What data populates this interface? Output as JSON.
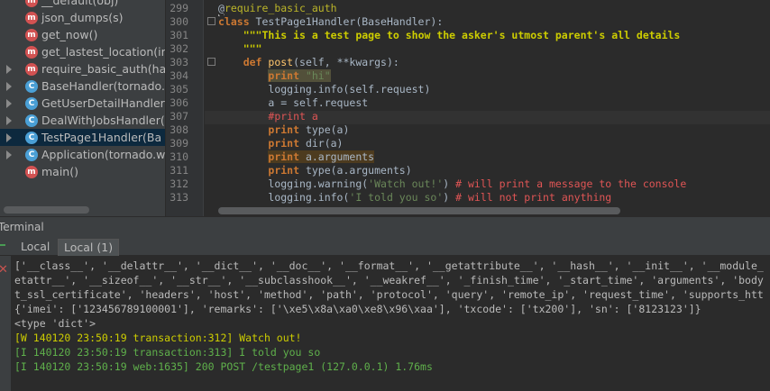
{
  "structure": {
    "items": [
      {
        "badge": "m",
        "label": "__default(obj)",
        "expandable": false,
        "selected": false
      },
      {
        "badge": "m",
        "label": "json_dumps(s)",
        "expandable": false,
        "selected": false
      },
      {
        "badge": "m",
        "label": "get_now()",
        "expandable": false,
        "selected": false
      },
      {
        "badge": "m",
        "label": "get_lastest_location(im",
        "expandable": false,
        "selected": false
      },
      {
        "badge": "m",
        "label": "require_basic_auth(ha",
        "expandable": true,
        "selected": false
      },
      {
        "badge": "C",
        "label": "BaseHandler(tornado.",
        "expandable": true,
        "selected": false
      },
      {
        "badge": "C",
        "label": "GetUserDetailHandler",
        "expandable": true,
        "selected": false
      },
      {
        "badge": "C",
        "label": "DealWithJobsHandler(",
        "expandable": true,
        "selected": false
      },
      {
        "badge": "C",
        "label": "TestPage1Handler(Ba",
        "expandable": true,
        "selected": true
      },
      {
        "badge": "C",
        "label": "Application(tornado.w",
        "expandable": true,
        "selected": false
      },
      {
        "badge": "m",
        "label": "main()",
        "expandable": false,
        "selected": false
      }
    ]
  },
  "editor": {
    "line_numbers": [
      "299",
      "300",
      "301",
      "302",
      "303",
      "304",
      "305",
      "306",
      "307",
      "308",
      "309",
      "310",
      "311",
      "312",
      "313"
    ],
    "current_line": "307"
  },
  "terminal": {
    "title": "Terminal",
    "tabs": [
      "Local",
      "Local (1)"
    ],
    "active_tab": "Local (1)",
    "lines": [
      {
        "text": "['__class__', '__delattr__', '__dict__', '__doc__', '__format__', '__getattribute__', '__hash__', '__init__', '__module_",
        "level": "plain"
      },
      {
        "text": "etattr__', '__sizeof__', '__str__', '__subclasshook__', '__weakref__', '_finish_time', '_start_time', 'arguments', 'body",
        "level": "plain"
      },
      {
        "text": "t_ssl_certificate', 'headers', 'host', 'method', 'path', 'protocol', 'query', 'remote_ip', 'request_time', 'supports_htt",
        "level": "plain"
      },
      {
        "text": "{'imei': ['123456789100001'], 'remarks': ['\\xe5\\x8a\\xa0\\xe8\\x96\\xaa'], 'txcode': ['tx200'], 'sn': ['8123123']}",
        "level": "plain"
      },
      {
        "text": "<type 'dict'>",
        "level": "plain"
      },
      {
        "text": "[W 140120 23:50:19 transaction:312] Watch out!",
        "level": "warn"
      },
      {
        "text": "[I 140120 23:50:19 transaction:313] I told you so",
        "level": "info"
      },
      {
        "text": "[I 140120 23:50:19 web:1635] 200 POST /testpage1 (127.0.0.1) 1.76ms",
        "level": "info"
      }
    ]
  },
  "code": {
    "l299_at": "@",
    "l299_name": "require_basic_auth",
    "l300_kw": "class",
    "l300_name": " TestPage1Handler(BaseHandler):",
    "l301_doc": "\"\"\"This is a test page to show the asker's utmost parent's all details",
    "l302_doc": "\"\"\"",
    "l303_kw": "def",
    "l303_fn": " post",
    "l303_rest": "(self, **kwargs):",
    "l304_kw": "print",
    "l304_str": " \"hi\"",
    "l305": "logging.info(self.request)",
    "l306": "a = self.request",
    "l307_cmt": "#print a",
    "l308_kw": "print",
    "l308_rest": " type(a)",
    "l309_kw": "print",
    "l309_rest": " dir(a)",
    "l310_kw": "print",
    "l310_rest": " a.arguments",
    "l311_kw": "print",
    "l311_rest": " type(a.arguments)",
    "l312_a": "logging.warning(",
    "l312_str": "'Watch out!'",
    "l312_b": ")",
    "l312_cmt": " # will print a message to the console",
    "l313_a": "logging.info(",
    "l313_str": "'I told you so'",
    "l313_b": ")",
    "l313_cmt": " # will not print anything"
  }
}
